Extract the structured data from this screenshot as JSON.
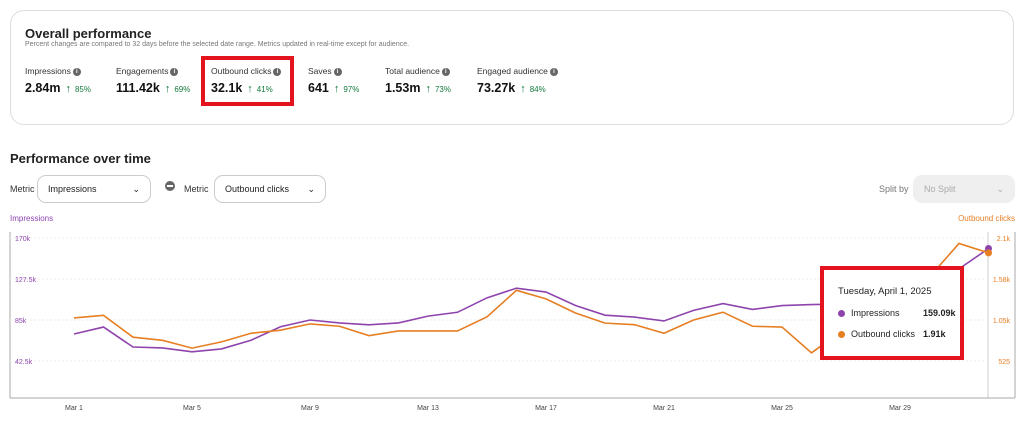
{
  "overview": {
    "title": "Overall performance",
    "subtitle": "Percent changes are compared to 32 days before the selected date range. Metrics updated in real-time except for audience.",
    "metrics": [
      {
        "label": "Impressions",
        "value": "2.84m",
        "change": "85%",
        "trend": "up"
      },
      {
        "label": "Engagements",
        "value": "111.42k",
        "change": "69%",
        "trend": "up"
      },
      {
        "label": "Outbound clicks",
        "value": "32.1k",
        "change": "41%",
        "trend": "up",
        "highlighted": true
      },
      {
        "label": "Saves",
        "value": "641",
        "change": "97%",
        "trend": "up"
      },
      {
        "label": "Total audience",
        "value": "1.53m",
        "change": "73%",
        "trend": "up"
      },
      {
        "label": "Engaged audience",
        "value": "73.27k",
        "change": "84%",
        "trend": "up"
      }
    ]
  },
  "performance": {
    "title": "Performance over time",
    "metric_label": "Metric",
    "metric1": "Impressions",
    "metric2": "Outbound clicks",
    "split_label": "Split by",
    "split_value": "No Split",
    "remove_icon": "minus-circle-icon"
  },
  "colors": {
    "impressions": "#8e44ad",
    "outbound": "#e67e22",
    "highlight": "#e3141e",
    "positive": "#137a3d"
  },
  "chart_data": {
    "type": "line",
    "left_axis_label": "Impressions",
    "right_axis_label": "Outbound clicks",
    "left_ticks": [
      "170k",
      "127.5k",
      "85k",
      "42.5k"
    ],
    "left_tick_values": [
      170000,
      127500,
      85000,
      42500
    ],
    "left_ylim": [
      0,
      170000
    ],
    "right_ticks": [
      "2.1k",
      "1.58k",
      "1.05k",
      "525"
    ],
    "right_tick_values": [
      2100,
      1575,
      1050,
      525
    ],
    "right_ylim": [
      0,
      2100
    ],
    "x": [
      "Mar 1",
      "Mar 2",
      "Mar 3",
      "Mar 4",
      "Mar 5",
      "Mar 6",
      "Mar 7",
      "Mar 8",
      "Mar 9",
      "Mar 10",
      "Mar 11",
      "Mar 12",
      "Mar 13",
      "Mar 14",
      "Mar 15",
      "Mar 16",
      "Mar 17",
      "Mar 18",
      "Mar 19",
      "Mar 20",
      "Mar 21",
      "Mar 22",
      "Mar 23",
      "Mar 24",
      "Mar 25",
      "Mar 26",
      "Mar 27",
      "Mar 28",
      "Mar 29",
      "Mar 30",
      "Mar 31",
      "Apr 1"
    ],
    "x_tick_labels": [
      "Mar 1",
      "Mar 5",
      "Mar 9",
      "Mar 13",
      "Mar 17",
      "Mar 21",
      "Mar 25",
      "Mar 29"
    ],
    "series": [
      {
        "name": "Impressions",
        "axis": "left",
        "values": [
          70500,
          77700,
          57000,
          56000,
          52000,
          55000,
          64000,
          78000,
          85000,
          82000,
          80000,
          82000,
          89000,
          93000,
          108000,
          118000,
          114000,
          100000,
          90000,
          88000,
          84000,
          95000,
          102000,
          96000,
          100000,
          101000,
          101500,
          102000,
          103000,
          120000,
          138000,
          159090
        ]
      },
      {
        "name": "Outbound clicks",
        "axis": "right",
        "values": [
          1076,
          1110,
          830,
          790,
          690,
          770,
          880,
          920,
          1000,
          970,
          850,
          910,
          910,
          910,
          1090,
          1430,
          1320,
          1140,
          1010,
          990,
          880,
          1050,
          1150,
          970,
          960,
          630,
          900,
          1100,
          1300,
          1600,
          2030,
          1910
        ]
      }
    ],
    "grid": true,
    "tooltip": {
      "date": "Tuesday, April 1, 2025",
      "rows": [
        {
          "name": "Impressions",
          "value": "159.09k"
        },
        {
          "name": "Outbound clicks",
          "value": "1.91k"
        }
      ]
    }
  }
}
